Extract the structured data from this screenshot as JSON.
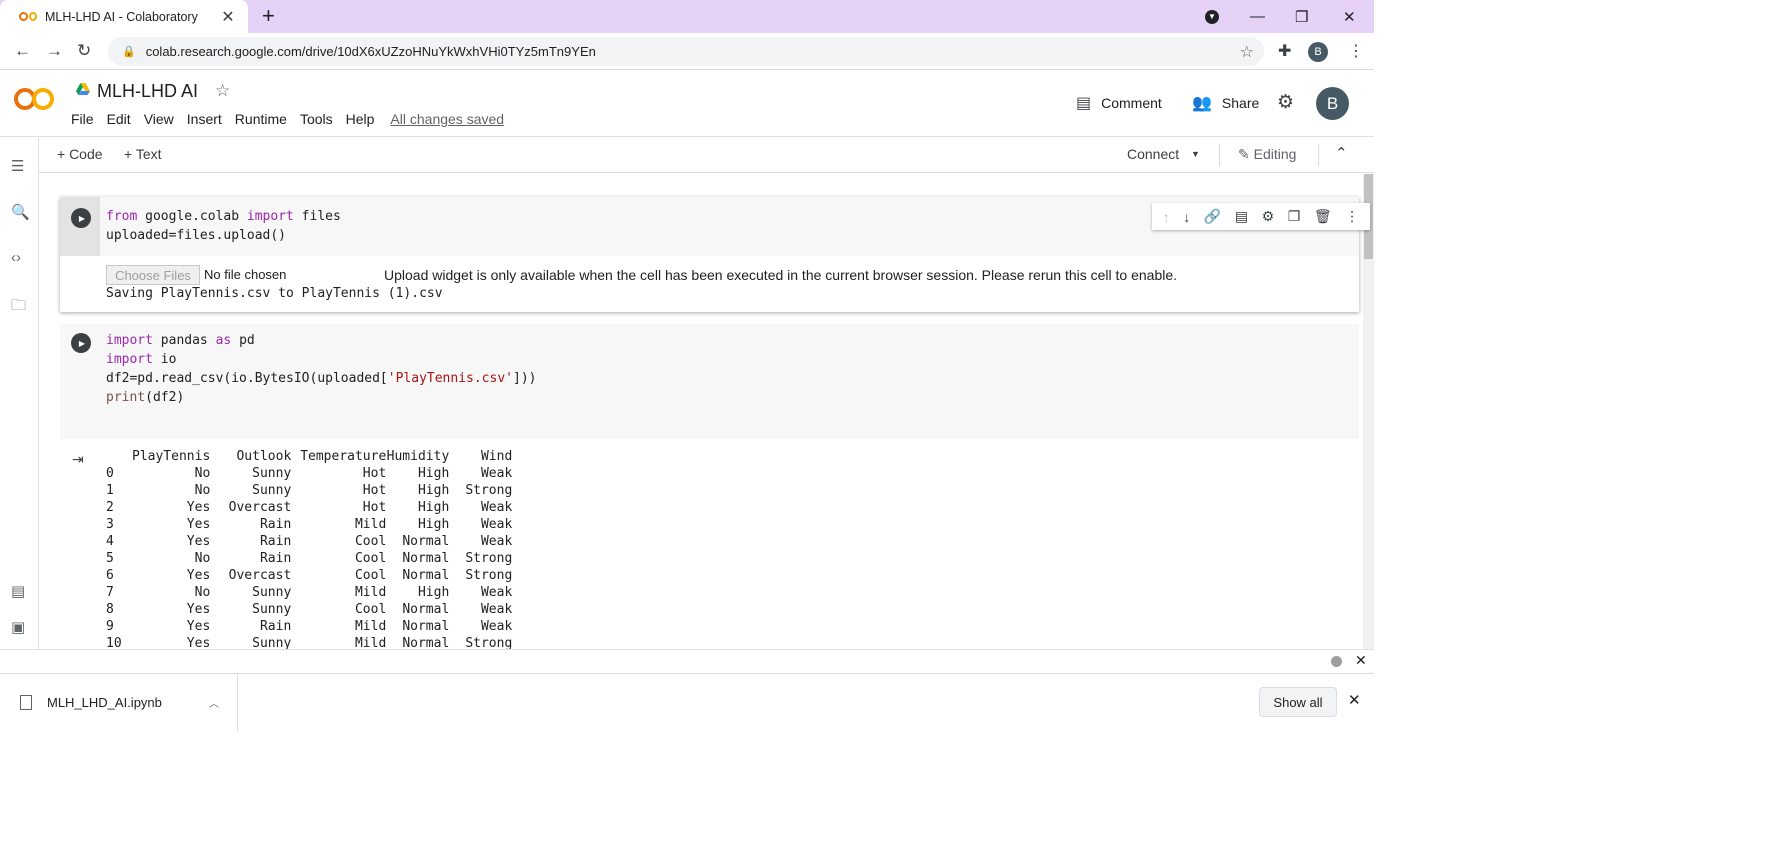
{
  "browser": {
    "tab_title": "MLH-LHD AI - Colaboratory",
    "tab_close": "✕",
    "new_tab": "+",
    "url": "colab.research.google.com/drive/10dX6xUZzoHNuYkWxhVHi0TYz5mTn9YEn",
    "profile_initial": "B"
  },
  "colab": {
    "notebook_title": "MLH-LHD AI",
    "menu": [
      "File",
      "Edit",
      "View",
      "Insert",
      "Runtime",
      "Tools",
      "Help"
    ],
    "save_status": "All changes saved",
    "comment_label": "Comment",
    "share_label": "Share",
    "avatar_initial": "B",
    "add_code": "+ Code",
    "add_text": "+ Text",
    "connect_label": "Connect",
    "editing_label": "Editing"
  },
  "cells": {
    "cell1": {
      "line1": {
        "kw1": "from",
        "mod": " google.colab ",
        "kw2": "import",
        "name": " files"
      },
      "line2": "uploaded=files.upload()",
      "choose_files": "Choose Files",
      "no_file": "No file chosen",
      "upload_message": "Upload widget is only available when the cell has been executed in the current browser session. Please rerun this cell to enable.",
      "saving": "Saving PlayTennis.csv to PlayTennis (1).csv"
    },
    "cell2": {
      "l1": {
        "kw1": "import",
        "mod": " pandas ",
        "kw2": "as",
        "alias": " pd"
      },
      "l2": {
        "kw": "import",
        "mod": " io"
      },
      "l3": {
        "pre": "df2=pd.read_csv(io.BytesIO(uploaded[",
        "str": "'PlayTennis.csv'",
        "post": "]))"
      },
      "l4": {
        "fn": "print",
        "args": "(df2)"
      }
    }
  },
  "dataframe": {
    "columns": [
      "PlayTennis",
      "Outlook",
      "Temperature",
      "Humidity",
      "Wind"
    ],
    "rows": [
      [
        "0",
        "No",
        "Sunny",
        "Hot",
        "High",
        "Weak"
      ],
      [
        "1",
        "No",
        "Sunny",
        "Hot",
        "High",
        "Strong"
      ],
      [
        "2",
        "Yes",
        "Overcast",
        "Hot",
        "High",
        "Weak"
      ],
      [
        "3",
        "Yes",
        "Rain",
        "Mild",
        "High",
        "Weak"
      ],
      [
        "4",
        "Yes",
        "Rain",
        "Cool",
        "Normal",
        "Weak"
      ],
      [
        "5",
        "No",
        "Rain",
        "Cool",
        "Normal",
        "Strong"
      ],
      [
        "6",
        "Yes",
        "Overcast",
        "Cool",
        "Normal",
        "Strong"
      ],
      [
        "7",
        "No",
        "Sunny",
        "Mild",
        "High",
        "Weak"
      ],
      [
        "8",
        "Yes",
        "Sunny",
        "Cool",
        "Normal",
        "Weak"
      ],
      [
        "9",
        "Yes",
        "Rain",
        "Mild",
        "Normal",
        "Weak"
      ],
      [
        "10",
        "Yes",
        "Sunny",
        "Mild",
        "Normal",
        "Strong"
      ]
    ]
  },
  "downloads": {
    "file_name": "MLH_LHD_AI.ipynb",
    "show_all": "Show all"
  },
  "colors": {
    "titlebar": "#e7d2f7",
    "colab_orange": "#e8710a",
    "colab_yellow": "#f9ab00",
    "keyword": "#9c27b0",
    "string": "#a31515"
  }
}
